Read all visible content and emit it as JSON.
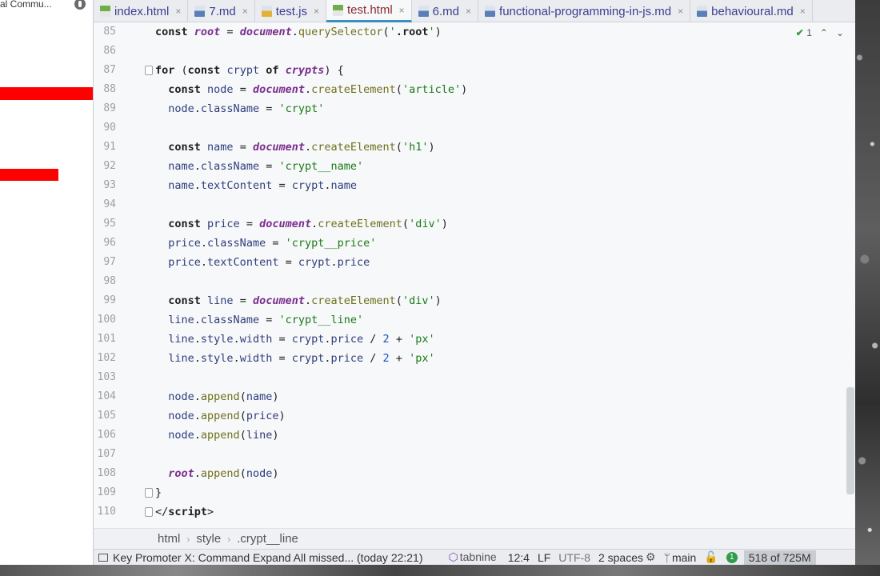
{
  "browser": {
    "tab_title": "al Commu..."
  },
  "tabs": [
    {
      "label": "index.html",
      "kind": "html",
      "active": false
    },
    {
      "label": "7.md",
      "kind": "md",
      "active": false
    },
    {
      "label": "test.js",
      "kind": "js",
      "active": false
    },
    {
      "label": "test.html",
      "kind": "html",
      "active": true
    },
    {
      "label": "6.md",
      "kind": "md",
      "active": false
    },
    {
      "label": "functional-programming-in-js.md",
      "kind": "md",
      "active": false
    },
    {
      "label": "behavioural.md",
      "kind": "md",
      "active": false
    }
  ],
  "inspection": {
    "count": "1"
  },
  "code_lines": [
    {
      "n": "85",
      "html": "<span class=\"kw\">const</span> <span class=\"it\">root</span> = <span class=\"it\">document</span>.<span class=\"fn\">querySelector</span>(<span class=\"str\">'</span><span class=\"kw\">.root</span><span class=\"str\">'</span>)"
    },
    {
      "n": "86",
      "html": ""
    },
    {
      "n": "87",
      "html": "<span class=\"kw\">for</span> (<span class=\"kw\">const</span> <span class=\"var\">crypt</span> <span class=\"kw\">of</span> <span class=\"it\">crypts</span>) {",
      "fold": true
    },
    {
      "n": "88",
      "html": "  <span class=\"kw\">const</span> <span class=\"var\">node</span> = <span class=\"it\">document</span>.<span class=\"fn\">createElement</span>(<span class=\"str\">'article'</span>)"
    },
    {
      "n": "89",
      "html": "  <span class=\"var\">node</span>.<span class=\"var\">className</span> = <span class=\"str\">'crypt'</span>"
    },
    {
      "n": "90",
      "html": ""
    },
    {
      "n": "91",
      "html": "  <span class=\"kw\">const</span> <span class=\"var\">name</span> = <span class=\"it\">document</span>.<span class=\"fn\">createElement</span>(<span class=\"str\">'h1'</span>)"
    },
    {
      "n": "92",
      "html": "  <span class=\"var\">name</span>.<span class=\"var\">className</span> = <span class=\"str\">'crypt__name'</span>"
    },
    {
      "n": "93",
      "html": "  <span class=\"var\">name</span>.<span class=\"var\">textContent</span> = <span class=\"var\">crypt</span>.<span class=\"var\">name</span>"
    },
    {
      "n": "94",
      "html": ""
    },
    {
      "n": "95",
      "html": "  <span class=\"kw\">const</span> <span class=\"var\">price</span> = <span class=\"it\">document</span>.<span class=\"fn\">createElement</span>(<span class=\"str\">'div'</span>)"
    },
    {
      "n": "96",
      "html": "  <span class=\"var\">price</span>.<span class=\"var\">className</span> = <span class=\"str\">'crypt__price'</span>"
    },
    {
      "n": "97",
      "html": "  <span class=\"var\">price</span>.<span class=\"var\">textContent</span> = <span class=\"var\">crypt</span>.<span class=\"var\">price</span>"
    },
    {
      "n": "98",
      "html": ""
    },
    {
      "n": "99",
      "html": "  <span class=\"kw\">const</span> <span class=\"var\">line</span> = <span class=\"it\">document</span>.<span class=\"fn\">createElement</span>(<span class=\"str\">'div'</span>)"
    },
    {
      "n": "100",
      "html": "  <span class=\"var\">line</span>.<span class=\"var\">className</span> = <span class=\"str\">'crypt__line'</span>"
    },
    {
      "n": "101",
      "html": "  <span class=\"var\">line</span>.<span class=\"var\">style</span>.<span class=\"var\">width</span> = <span class=\"var\">crypt</span>.<span class=\"var\">price</span> / <span class=\"num\">2</span> + <span class=\"str\">'px'</span>"
    },
    {
      "n": "102",
      "html": "  <span class=\"var\">line</span>.<span class=\"var\">style</span>.<span class=\"var\">width</span> = <span class=\"var\">crypt</span>.<span class=\"var\">price</span> / <span class=\"num\">2</span> + <span class=\"str\">'px'</span>"
    },
    {
      "n": "103",
      "html": ""
    },
    {
      "n": "104",
      "html": "  <span class=\"var\">node</span>.<span class=\"fn\">append</span>(<span class=\"var\">name</span>)"
    },
    {
      "n": "105",
      "html": "  <span class=\"var\">node</span>.<span class=\"fn\">append</span>(<span class=\"var\">price</span>)"
    },
    {
      "n": "106",
      "html": "  <span class=\"var\">node</span>.<span class=\"fn\">append</span>(<span class=\"var\">line</span>)"
    },
    {
      "n": "107",
      "html": ""
    },
    {
      "n": "108",
      "html": "  <span class=\"it\">root</span>.<span class=\"fn\">append</span>(<span class=\"var\">node</span>)"
    },
    {
      "n": "109",
      "html": "}",
      "fold": true
    },
    {
      "n": "110",
      "html": "&lt;/<span class=\"kw\">script</span>&gt;",
      "fold": true
    }
  ],
  "breadcrumb": [
    "html",
    "style",
    ".crypt__line"
  ],
  "status": {
    "message": "Key Promoter X: Command Expand All missed... (today 22:21)",
    "plugin": "tabnine",
    "position": "12:4",
    "line_separator": "LF",
    "encoding": "UTF-8",
    "indent": "2 spaces",
    "branch": "main",
    "notifications": "1",
    "memory": "518 of 725M"
  }
}
